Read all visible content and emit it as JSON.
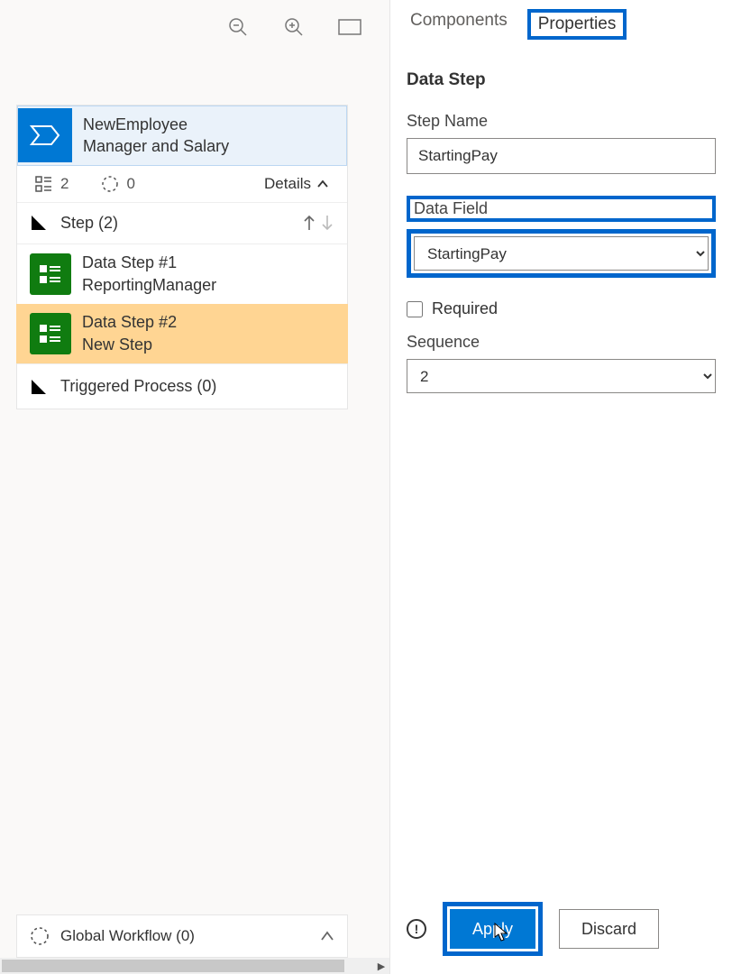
{
  "toolbar": {
    "zoom_out": "zoom-out",
    "zoom_in": "zoom-in",
    "fit": "fit-to-screen"
  },
  "process_card": {
    "title_line1": "NewEmployee",
    "title_line2": "Manager and Salary",
    "steps_count": "2",
    "progress_count": "0",
    "details_label": "Details",
    "steps_header": "Step (2)",
    "steps": [
      {
        "title": "Data Step #1",
        "subtitle": "ReportingManager"
      },
      {
        "title": "Data Step #2",
        "subtitle": "New Step"
      }
    ],
    "triggered": "Triggered Process (0)"
  },
  "footer": {
    "label": "Global Workflow (0)"
  },
  "tabs": {
    "components": "Components",
    "properties": "Properties"
  },
  "properties": {
    "section_title": "Data Step",
    "step_name_label": "Step Name",
    "step_name_value": "StartingPay",
    "data_field_label": "Data Field",
    "data_field_value": "StartingPay",
    "required_label": "Required",
    "required_checked": false,
    "sequence_label": "Sequence",
    "sequence_value": "2"
  },
  "buttons": {
    "apply": "Apply",
    "discard": "Discard"
  }
}
